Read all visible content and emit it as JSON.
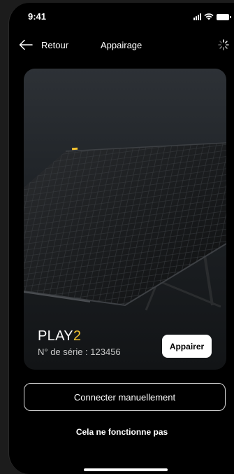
{
  "status_bar": {
    "time": "9:41"
  },
  "nav": {
    "back_label": "Retour",
    "title": "Appairage",
    "loading_icon": "spinner-icon"
  },
  "product": {
    "name_main": "PLAY",
    "name_accent": "2",
    "serial": "N° de série : 123456",
    "pair_label": "Appairer",
    "accent_color": "#f2c230"
  },
  "actions": {
    "manual_label": "Connecter manuellement",
    "help_label": "Cela ne fonctionne pas"
  }
}
